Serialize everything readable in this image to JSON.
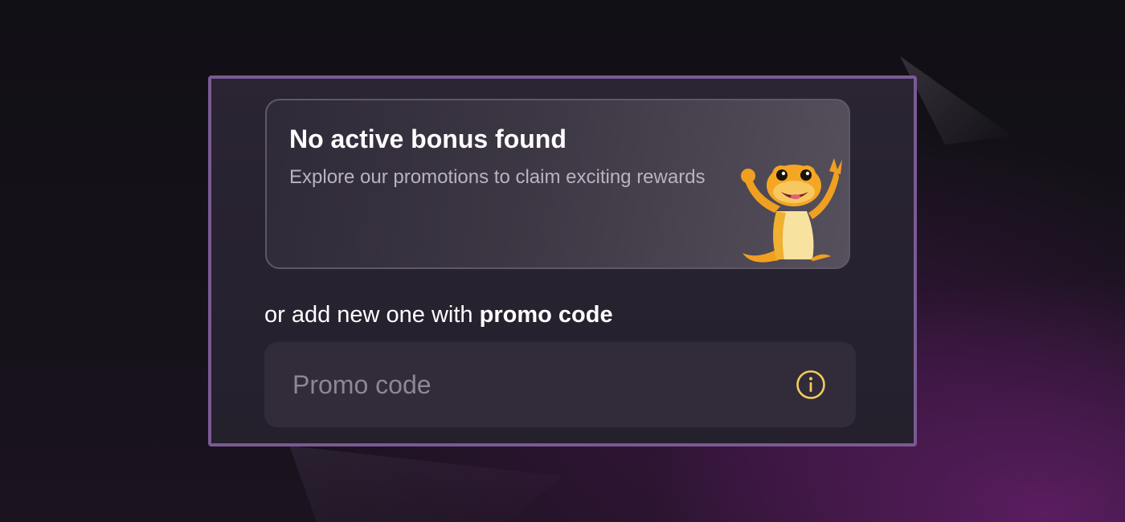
{
  "bonus_card": {
    "title": "No active bonus found",
    "subtitle": "Explore our promotions to claim exciting rewards",
    "mascot_icon": "gecko-mascot"
  },
  "promo": {
    "label_prefix": "or add new one with ",
    "label_bold": "promo code",
    "input_placeholder": "Promo code",
    "input_value": "",
    "info_icon": "info-icon"
  },
  "colors": {
    "panel_border": "#7a5a94",
    "info_icon": "#f2cc5a",
    "mascot_orange": "#f5a623",
    "background_purple": "#5a1d60"
  }
}
